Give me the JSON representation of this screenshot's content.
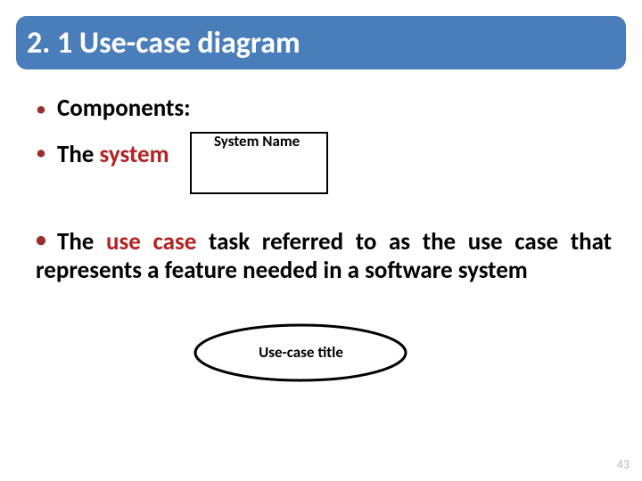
{
  "title": "2. 1 Use-case diagram",
  "bullets": {
    "components_label": "Components:",
    "the": "The ",
    "system_word": "system",
    "system_box_label": "System Name",
    "usecase_sentence_pre": "The ",
    "usecase_red": "use case",
    "usecase_sentence_post": " task referred to as the use case that represents a feature needed in a software system",
    "usecase_ellipse_label": "Use-case title"
  },
  "page_number": "43"
}
